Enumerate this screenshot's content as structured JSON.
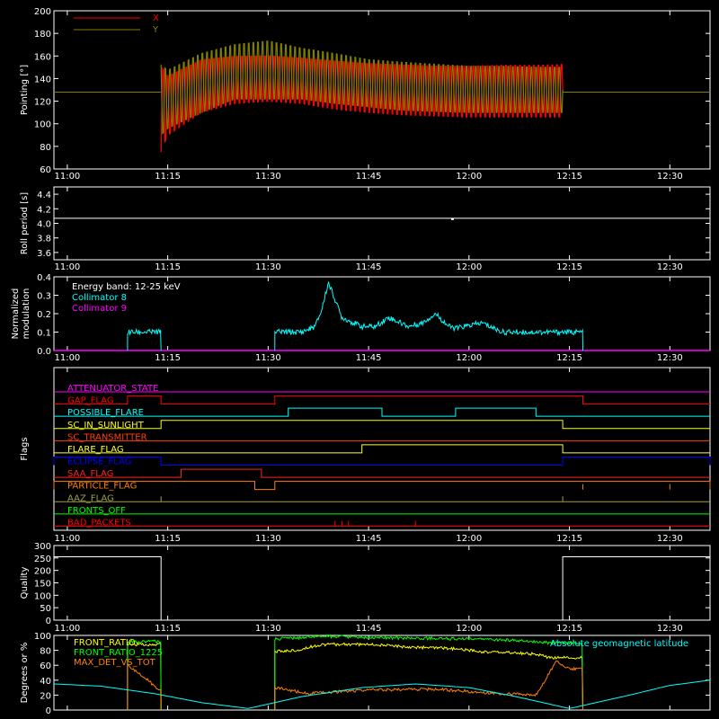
{
  "time_ticks": [
    "11:00",
    "11:15",
    "11:30",
    "11:45",
    "12:00",
    "12:15",
    "12:30"
  ],
  "chart_data": [
    {
      "type": "line",
      "id": "pointing",
      "ylabel": "Pointing [°]",
      "ylim": [
        60,
        200
      ],
      "yticks": [
        "60",
        "80",
        "100",
        "120",
        "140",
        "160",
        "180",
        "200"
      ],
      "series": [
        {
          "name": "X",
          "color": "#ff0000"
        },
        {
          "name": "Y",
          "color": "#808000"
        }
      ],
      "constant_line": 128,
      "data_span": [
        "11:14",
        "12:14"
      ],
      "x_envelope": {
        "x": [
          "11:14",
          "11:15",
          "11:20",
          "11:25",
          "11:30",
          "11:35",
          "11:40",
          "11:45",
          "11:50",
          "11:55",
          "12:00",
          "12:05",
          "12:10",
          "12:14"
        ],
        "upper": [
          170,
          155,
          168,
          170,
          170,
          168,
          166,
          164,
          163,
          162,
          162,
          163,
          163,
          164
        ],
        "lower": [
          75,
          90,
          110,
          118,
          120,
          118,
          113,
          110,
          108,
          107,
          106,
          106,
          106,
          106
        ]
      },
      "y_envelope": {
        "x": [
          "11:14",
          "11:15",
          "11:20",
          "11:25",
          "11:30",
          "11:35",
          "11:40",
          "11:45",
          "11:50",
          "11:55",
          "12:00",
          "12:05",
          "12:10",
          "12:14"
        ],
        "upper": [
          168,
          160,
          175,
          182,
          186,
          178,
          173,
          167,
          165,
          163,
          161,
          161,
          160,
          160
        ],
        "lower": [
          90,
          96,
          110,
          122,
          122,
          122,
          118,
          115,
          112,
          111,
          110,
          110,
          110,
          110
        ]
      }
    },
    {
      "type": "line",
      "id": "roll_period",
      "ylabel": "Roll period [s]",
      "ylim": [
        3.5,
        4.5
      ],
      "yticks": [
        "3.6",
        "3.8",
        "4.0",
        "4.2",
        "4.4"
      ],
      "series": [
        {
          "name": "",
          "color": "#ffffff",
          "value": 4.07
        }
      ]
    },
    {
      "type": "line",
      "id": "modulation",
      "ylabel": "Normalized modulation",
      "ylim": [
        0,
        0.4
      ],
      "yticks": [
        "0.0",
        "0.1",
        "0.2",
        "0.3",
        "0.4"
      ],
      "legend": [
        "Energy band: 12-25 keV",
        "Collimator 8",
        "Collimator 9"
      ],
      "series": [
        {
          "name": "Collimator 8",
          "color": "#00ffff",
          "x": [
            "11:09",
            "11:14",
            "11:31",
            "11:35",
            "11:37",
            "11:38",
            "11:39",
            "11:41",
            "11:44",
            "11:46",
            "11:48",
            "11:51",
            "11:53",
            "11:55",
            "11:57",
            "11:58",
            "12:02",
            "12:05",
            "12:10",
            "12:15",
            "12:17"
          ],
          "values": [
            0.1,
            0.1,
            0.1,
            0.1,
            0.13,
            0.22,
            0.37,
            0.18,
            0.13,
            0.13,
            0.18,
            0.13,
            0.15,
            0.2,
            0.13,
            0.12,
            0.15,
            0.1,
            0.1,
            0.1,
            0.1
          ]
        },
        {
          "name": "Collimator 9",
          "color": "#ff00ff",
          "value": 0.0
        }
      ],
      "gaps": [
        [
          "11:14",
          "11:31"
        ],
        [
          "12:17",
          "12:36"
        ]
      ]
    },
    {
      "type": "step",
      "id": "flags",
      "ylabel": "Flags",
      "flags": [
        {
          "name": "ATTENUATOR_STATE",
          "color": "#ff00ff",
          "high": []
        },
        {
          "name": "GAP_FLAG",
          "color": "#ff0000",
          "high": [
            [
              "11:09",
              "11:14"
            ],
            [
              "11:31",
              "12:17"
            ]
          ]
        },
        {
          "name": "POSSIBLE_FLARE",
          "color": "#00ffff",
          "high": [
            [
              "11:33",
              "11:47"
            ],
            [
              "11:58",
              "12:10"
            ]
          ]
        },
        {
          "name": "SC_IN_SUNLIGHT",
          "color": "#ffff00",
          "high": [
            [
              "11:14",
              "12:14"
            ]
          ]
        },
        {
          "name": "SC_TRANSMITTER",
          "color": "#ff4000",
          "high": []
        },
        {
          "name": "FLARE_FLAG",
          "color": "#ffff40",
          "high": [
            [
              "11:44",
              "12:14"
            ]
          ]
        },
        {
          "name": "ECLIPSE_FLAG",
          "color": "#0000ff",
          "high": [
            [
              "10:58",
              "11:14"
            ],
            [
              "12:14",
              "12:36"
            ]
          ]
        },
        {
          "name": "SAA_FLAG",
          "color": "#ff2020",
          "high": [
            [
              "11:17",
              "11:29"
            ]
          ]
        },
        {
          "name": "PARTICLE_FLAG",
          "color": "#ff8000",
          "high": [
            [
              "10:58",
              "11:28"
            ],
            [
              "11:31",
              "12:36"
            ]
          ]
        },
        {
          "name": "AAZ_FLAG",
          "color": "#a0a040",
          "high": []
        },
        {
          "name": "FRONTS_OFF",
          "color": "#00ff00",
          "high": []
        },
        {
          "name": "BAD_PACKETS",
          "color": "#ff0000",
          "high": []
        }
      ]
    },
    {
      "type": "step",
      "id": "quality",
      "ylabel": "Quality",
      "ylim": [
        0,
        300
      ],
      "yticks": [
        "0",
        "50",
        "100",
        "150",
        "200",
        "250",
        "300"
      ],
      "series": [
        {
          "name": "",
          "color": "#ffffff",
          "x": [
            "10:58",
            "11:14",
            "11:14",
            "12:14",
            "12:14",
            "12:36"
          ],
          "values": [
            255,
            255,
            0,
            0,
            255,
            255
          ]
        }
      ]
    },
    {
      "type": "line",
      "id": "ratios",
      "ylabel": "Degrees or %",
      "ylim": [
        0,
        100
      ],
      "yticks": [
        "0",
        "20",
        "40",
        "60",
        "80",
        "100"
      ],
      "legend_right": "Absolute geomagnetic latitude",
      "series": [
        {
          "name": "FRONT_RATIO",
          "color": "#ffff00",
          "segments": [
            {
              "x": [
                "11:09",
                "11:14"
              ],
              "values": [
                88,
                88
              ]
            },
            {
              "x": [
                "11:31",
                "11:34",
                "11:38",
                "11:45",
                "11:50",
                "11:55",
                "11:58",
                "12:02",
                "12:06",
                "12:10",
                "12:12",
                "12:17"
              ],
              "values": [
                78,
                80,
                88,
                88,
                85,
                83,
                82,
                78,
                77,
                75,
                70,
                70
              ]
            }
          ]
        },
        {
          "name": "FRONT_RATIO_1225",
          "color": "#00ff00",
          "segments": [
            {
              "x": [
                "11:09",
                "11:14"
              ],
              "values": [
                92,
                92
              ]
            },
            {
              "x": [
                "11:31",
                "11:38",
                "11:45",
                "11:55",
                "12:05",
                "12:10",
                "12:12",
                "12:17"
              ],
              "values": [
                95,
                99,
                97,
                96,
                94,
                92,
                90,
                90
              ]
            }
          ]
        },
        {
          "name": "MAX_DET_VS_TOT",
          "color": "#ff8000",
          "segments": [
            {
              "x": [
                "11:09",
                "11:12",
                "11:14"
              ],
              "values": [
                60,
                40,
                25
              ]
            },
            {
              "x": [
                "11:31",
                "11:36",
                "11:45",
                "11:55",
                "12:05",
                "12:10",
                "12:13",
                "12:15",
                "12:17"
              ],
              "values": [
                30,
                22,
                27,
                28,
                22,
                20,
                65,
                55,
                55
              ]
            }
          ]
        },
        {
          "name": "Absolute geomagnetic latitude",
          "color": "#00ffff",
          "x": [
            "10:58",
            "11:05",
            "11:13",
            "11:20",
            "11:27",
            "11:35",
            "11:44",
            "11:52",
            "12:00",
            "12:07",
            "12:15",
            "12:24",
            "12:30",
            "12:36"
          ],
          "values": [
            35,
            32,
            22,
            10,
            2,
            18,
            30,
            35,
            30,
            18,
            2,
            20,
            33,
            40
          ]
        }
      ]
    }
  ]
}
